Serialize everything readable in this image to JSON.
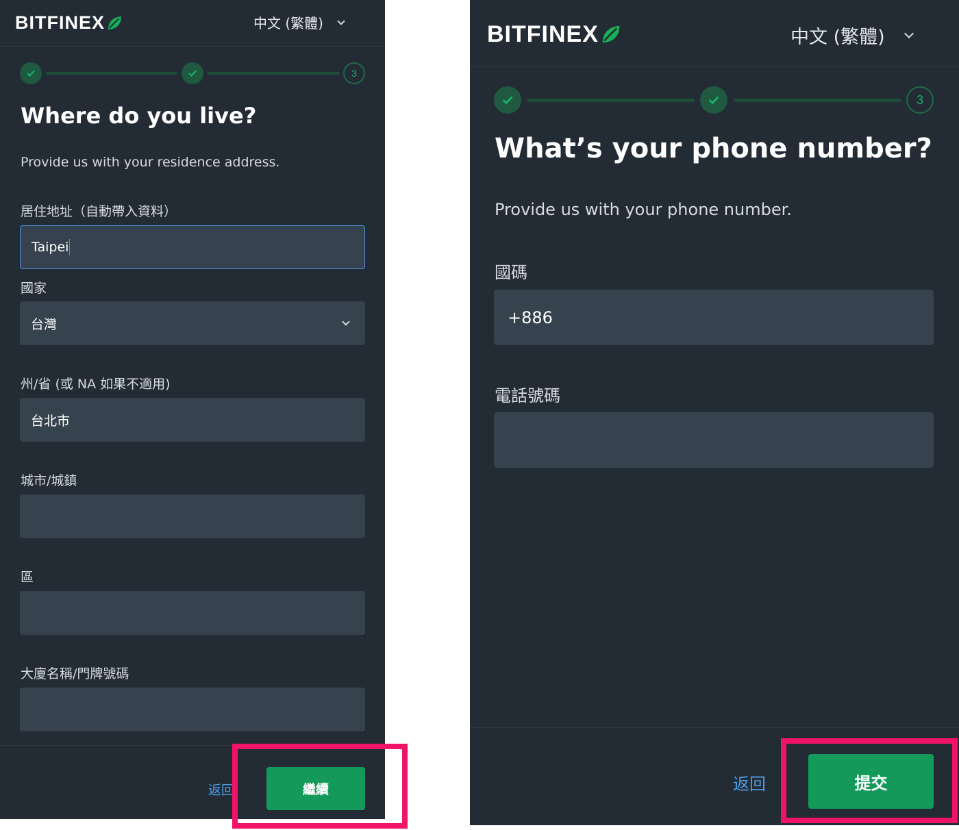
{
  "colors": {
    "panel_bg": "#232b35",
    "field_bg": "#36434f",
    "accent_green": "#139a5b",
    "step_green": "#17b26a",
    "link_blue": "#4d9ee8",
    "focus_blue": "#4d8fd8",
    "highlight_pink": "#f0136a"
  },
  "left": {
    "logo": "BITFINEX",
    "language": "中文 (繁體)",
    "steps": [
      "done",
      "done",
      "3"
    ],
    "title": "Where do you live?",
    "subtitle": "Provide us with your residence address.",
    "address_label": "居住地址（自動帶入資料）",
    "address_value": "Taipei",
    "country_label": "國家",
    "country_value": "台灣",
    "state_label": "州/省 (或 NA 如果不適用)",
    "state_value": "台北市",
    "city_label": "城市/城鎮",
    "city_value": "",
    "district_label": "區",
    "district_value": "",
    "building_label": "大廈名稱/門牌號碼",
    "building_value": "",
    "back_label": "返回",
    "continue_label": "繼續"
  },
  "right": {
    "logo": "BITFINEX",
    "language": "中文 (繁體)",
    "steps": [
      "done",
      "done",
      "3"
    ],
    "title": "What’s your phone number?",
    "subtitle": "Provide us with your phone number.",
    "country_code_label": "國碼",
    "country_code_value": "+886",
    "phone_label": "電話號碼",
    "phone_value": "",
    "back_label": "返回",
    "submit_label": "提交"
  }
}
